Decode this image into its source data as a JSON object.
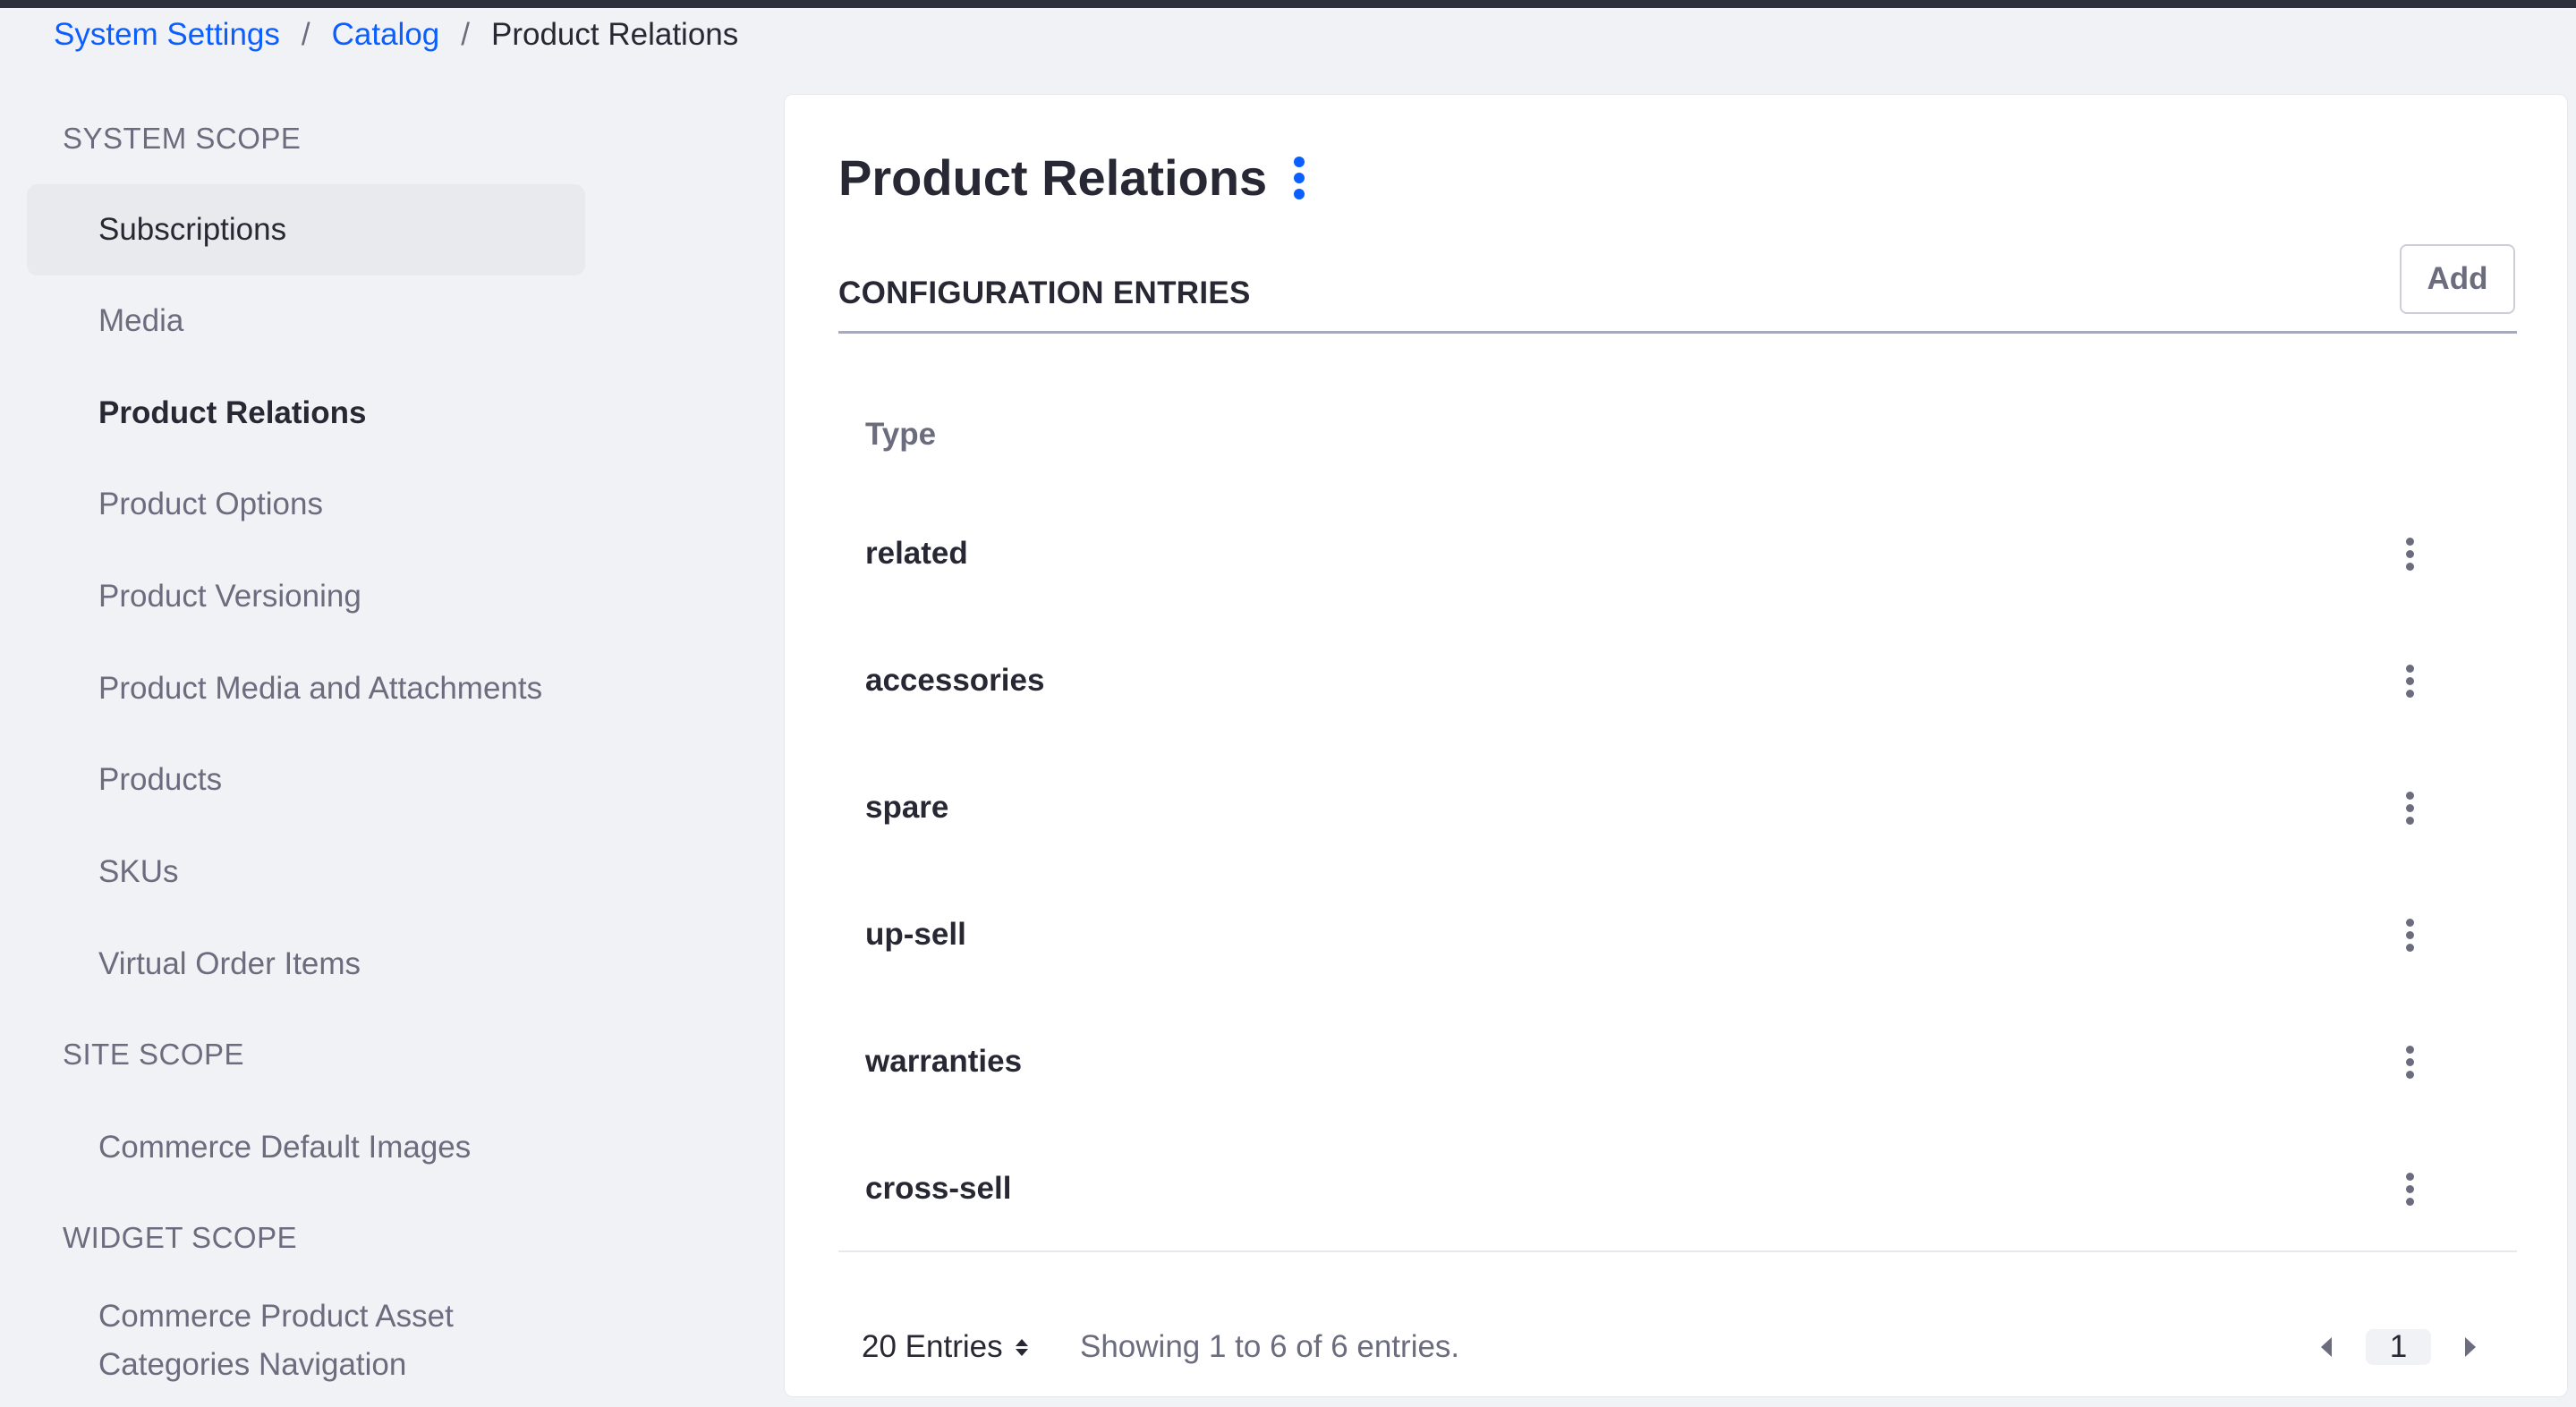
{
  "breadcrumb": {
    "items": [
      "System Settings",
      "Catalog"
    ],
    "separator": "/",
    "current": "Product Relations"
  },
  "sidebar": {
    "sections": [
      {
        "heading": "SYSTEM SCOPE",
        "items": [
          {
            "label": "Subscriptions",
            "state": "hover"
          },
          {
            "label": "Media",
            "state": ""
          },
          {
            "label": "Product Relations",
            "state": "active"
          },
          {
            "label": "Product Options",
            "state": ""
          },
          {
            "label": "Product Versioning",
            "state": ""
          },
          {
            "label": "Product Media and Attachments",
            "state": ""
          },
          {
            "label": "Products",
            "state": ""
          },
          {
            "label": "SKUs",
            "state": ""
          },
          {
            "label": "Virtual Order Items",
            "state": ""
          }
        ]
      },
      {
        "heading": "SITE SCOPE",
        "items": [
          {
            "label": "Commerce Default Images",
            "state": ""
          }
        ]
      },
      {
        "heading": "WIDGET SCOPE",
        "items": [
          {
            "label": "Commerce Product Asset Categories Navigation",
            "state": ""
          }
        ]
      }
    ]
  },
  "main": {
    "title": "Product Relations",
    "title_menu_icon": "ellipsis-vertical-icon",
    "section_title": "CONFIGURATION ENTRIES",
    "add_label": "Add",
    "table": {
      "columns": [
        "Type"
      ],
      "rows": [
        {
          "type": "related"
        },
        {
          "type": "accessories"
        },
        {
          "type": "spare"
        },
        {
          "type": "up-sell"
        },
        {
          "type": "warranties"
        },
        {
          "type": "cross-sell"
        }
      ],
      "row_action_icon": "ellipsis-vertical-icon"
    },
    "footer": {
      "entries_label": "20 Entries",
      "showing_text": "Showing 1 to 6 of 6 entries.",
      "current_page": "1"
    }
  },
  "colors": {
    "accent": "#0b5fff",
    "text_primary": "#272833",
    "text_secondary": "#6b6c7e",
    "background": "#f1f2f5",
    "top_bar": "#2e2f3d"
  }
}
